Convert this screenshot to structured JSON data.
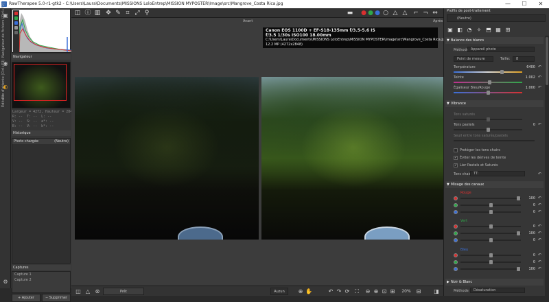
{
  "titlebar": {
    "title": "RawTherapee 5.0-r1-gtk2 - C:\\Users\\Laura\\Documents\\MISSIONS LoloEntrep\\MISSION MYPOSTER\\Image\\src\\Mangrove_Costa Rica.jpg",
    "min": "—",
    "max": "☐",
    "close": "✕"
  },
  "left_tabs": {
    "file_browser": "Navigateur de fichiers (Ctrl+F2)",
    "queue": "File d'attente (Ctrl+F3)",
    "editor": "Éditeur"
  },
  "left": {
    "navigator_label": "Navigateur",
    "navinfo": "Largeur = 4272, Hauteur = 284\nR: --  T: --  L: --\nV: --  S: --  a*: --\nB: --  V: --  b*: --",
    "history_label": "Historique",
    "history_cols": [
      "Photo chargée",
      "(Neutre)"
    ],
    "captures_label": "Captures",
    "captures": [
      "Capture 1",
      "Capture 2"
    ],
    "add_label": "+ Ajouter",
    "remove_label": "− Supprimer"
  },
  "viewer": {
    "before_label": "Avant",
    "after_label": "Après",
    "info_line1": "Canon EOS 1100D + EF-S18-135mm f/3.5-5.6 IS",
    "info_line2": "f/3.5  1/30s  ISO100  18.00mm",
    "info_line3": "C:\\Users\\Laura\\Documents\\MISSIONS LoloEntrep\\MISSION MYPOSTER\\Image\\src\\Mangrove_Costa Rica.jpg",
    "info_line4": "12.2 MP (4272x2848)"
  },
  "bottom": {
    "preview": "Prêt",
    "zoom_mode": "Auzun",
    "zoom": "20%"
  },
  "right": {
    "profile_title": "Profils de post-traitement",
    "profile_value": "(Neutre)",
    "wb": {
      "title": "Balance des blancs",
      "method_label": "Méthode",
      "method_value": "Appareil photo",
      "spot_label": "Point de mesure",
      "size_label": "Taille:",
      "size_value": "8",
      "temp_label": "Température",
      "temp_value": "6400",
      "tint_label": "Teinte",
      "tint_value": "1.002",
      "equal_label": "Égaliseur Bleu/Rouge",
      "equal_value": "1.000"
    },
    "vibrance": {
      "title": "Vibrance",
      "sat_label": "Tons saturés",
      "pastel_label": "Tons pastels",
      "pastel_value": "0",
      "threshold_label": "Seuil entre tons saturés/pastels",
      "protect_label": "Protéger les tons chairs",
      "avoid_label": "Éviter les dérives de teinte",
      "link_label": "Lier Pastels et Saturés",
      "skin_label": "Tons chair",
      "skin_value": "TT:"
    },
    "mixer": {
      "title": "Mixage des canaux",
      "red_label": "Rouge",
      "green_label": "Vert",
      "blue_label": "Bleu",
      "v100": "100",
      "v0": "0"
    },
    "bw": {
      "title": "Noir & Blanc",
      "method_label": "Méthode",
      "method_value": "Désaturation"
    }
  },
  "colors": {
    "accent": "#3b6db5",
    "red": "#d83030",
    "green": "#2fa84a",
    "blue": "#3a6fd8"
  }
}
